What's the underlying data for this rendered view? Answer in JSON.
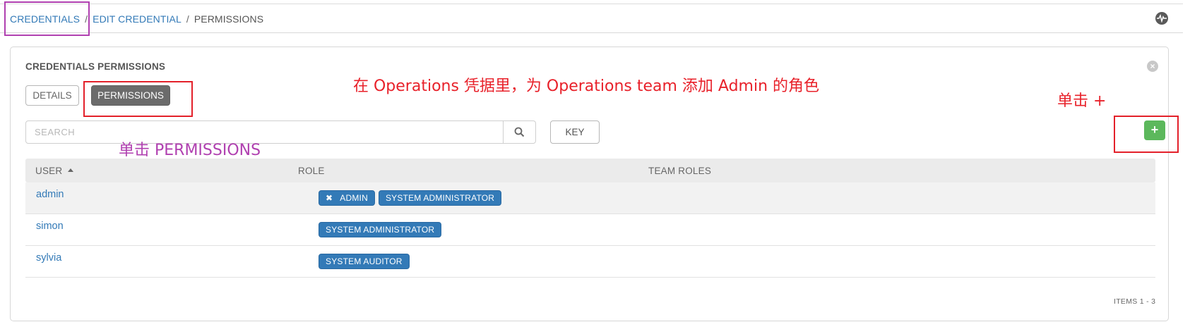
{
  "breadcrumb": {
    "credentials": "CREDENTIALS",
    "sep1": "/",
    "edit_credential": "EDIT CREDENTIAL",
    "sep2": "/",
    "current": "PERMISSIONS"
  },
  "topbar": {
    "activity_icon": "activity-stream-icon"
  },
  "panel": {
    "title": "CREDENTIALS PERMISSIONS",
    "close_icon": "close-icon",
    "tabs": [
      {
        "label": "DETAILS",
        "active": false
      },
      {
        "label": "PERMISSIONS",
        "active": true
      }
    ]
  },
  "search": {
    "placeholder": "SEARCH",
    "value": "",
    "icon": "search-icon"
  },
  "key_button": "KEY",
  "add_button": "+",
  "table": {
    "headers": [
      "USER",
      "ROLE",
      "TEAM ROLES"
    ],
    "sort_column": "USER",
    "rows": [
      {
        "user": "admin",
        "roles": [
          "ADMIN",
          "SYSTEM ADMINISTRATOR"
        ],
        "removable_roles": [
          "ADMIN"
        ],
        "team_roles": []
      },
      {
        "user": "simon",
        "roles": [
          "SYSTEM ADMINISTRATOR"
        ],
        "team_roles": []
      },
      {
        "user": "sylvia",
        "roles": [
          "SYSTEM AUDITOR"
        ],
        "team_roles": []
      }
    ]
  },
  "items_count": "ITEMS  1 - 3",
  "annotations": {
    "task": "在 Operations 凭据里，为 Operations team 添加 Admin 的角色",
    "click_plus": "单击 +",
    "click_permissions": "单击 PERMISSIONS"
  },
  "colors": {
    "link": "#337ab7",
    "role_tag": "#337ab7",
    "add_button": "#5cb85c",
    "active_tab": "#6b6b6b",
    "annotation_red": "#e8212a",
    "annotation_purple": "#b040b0"
  }
}
